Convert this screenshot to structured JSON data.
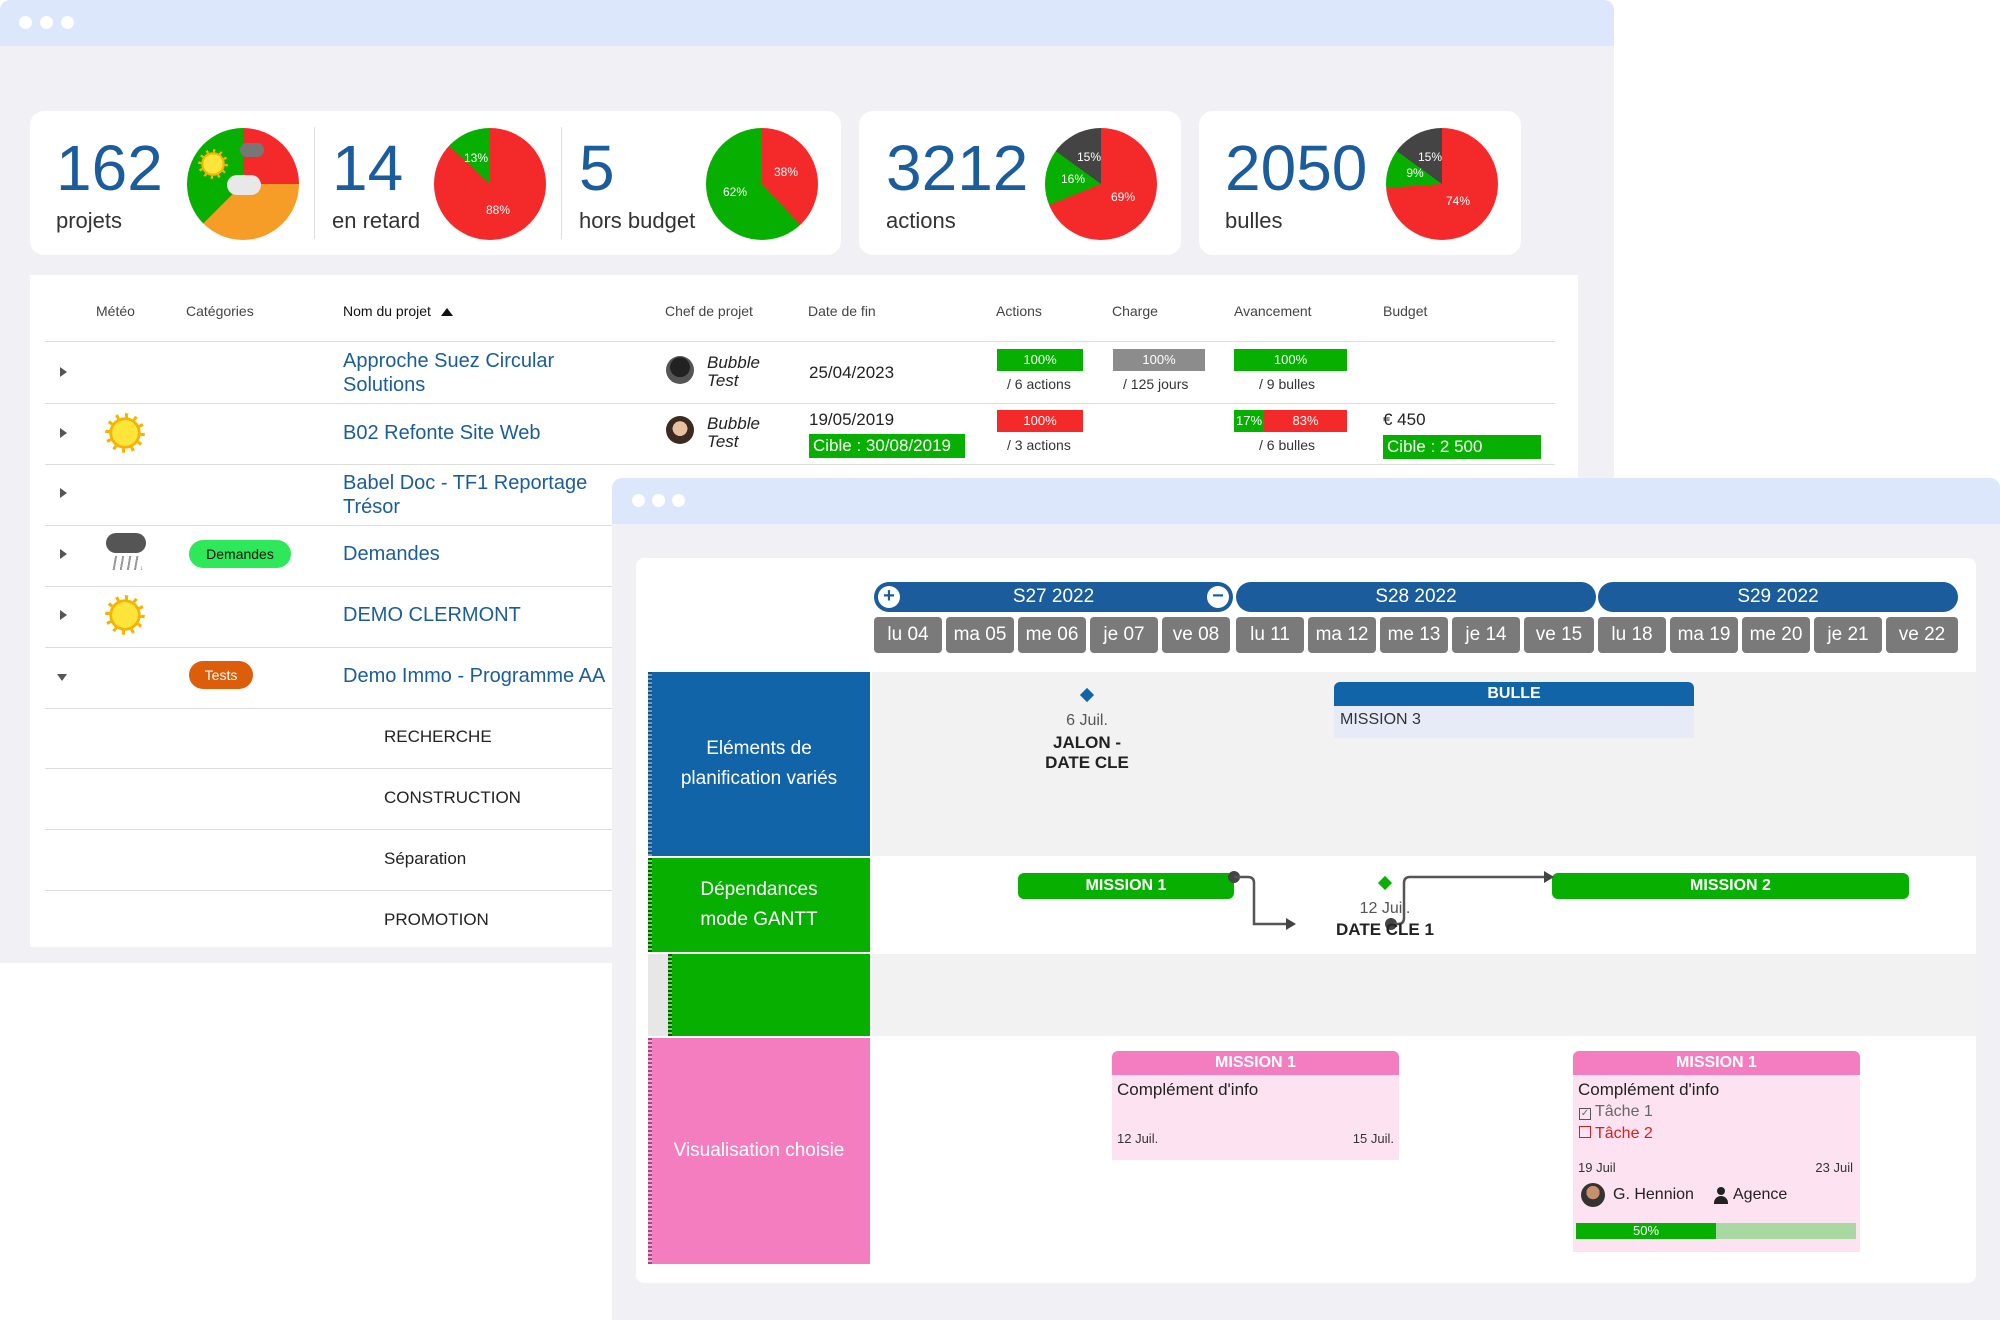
{
  "kpis": [
    {
      "number": "162",
      "label": "projets"
    },
    {
      "number": "14",
      "label": "en retard",
      "pie": [
        "13%",
        "88%"
      ]
    },
    {
      "number": "5",
      "label": "hors budget",
      "pie": [
        "38%",
        "62%"
      ]
    },
    {
      "number": "3212",
      "label": "actions",
      "pie": [
        "15%",
        "16%",
        "69%"
      ]
    },
    {
      "number": "2050",
      "label": "bulles",
      "pie": [
        "15%",
        "9%",
        "74%"
      ]
    }
  ],
  "table": {
    "headers": {
      "meteo": "Météo",
      "categories": "Catégories",
      "nom": "Nom du projet",
      "chef": "Chef de projet",
      "date": "Date de fin",
      "actions": "Actions",
      "charge": "Charge",
      "avancement": "Avancement",
      "budget": "Budget"
    },
    "rows": [
      {
        "name_line1": "Approche Suez Circular",
        "name_line2": "Solutions",
        "chef_line1": "Bubble",
        "chef_line2": "Test",
        "date": "25/04/2023",
        "actions_pct": "100%",
        "actions_sub": "/ 6 actions",
        "charge_pct": "100%",
        "charge_sub": "/ 125 jours",
        "avancement_pct": "100%",
        "avancement_sub": "/ 9 bulles"
      },
      {
        "name": "B02 Refonte Site Web",
        "chef_line1": "Bubble",
        "chef_line2": "Test",
        "date": "19/05/2019",
        "target_date": "Cible : 30/08/2019",
        "actions_pct": "100%",
        "actions_sub": "/ 3 actions",
        "avancement_a": "17%",
        "avancement_b": "83%",
        "avancement_sub": "/ 6 bulles",
        "budget": "€ 450",
        "budget_target": "Cible : 2 500"
      },
      {
        "name_line1": "Babel Doc - TF1 Reportage",
        "name_line2": "Trésor"
      },
      {
        "category": "Demandes",
        "name": "Demandes"
      },
      {
        "name": "DEMO CLERMONT"
      },
      {
        "category": "Tests",
        "name": "Demo Immo - Programme AA"
      }
    ],
    "subrows": [
      "RECHERCHE",
      "CONSTRUCTION",
      "Séparation",
      "PROMOTION"
    ]
  },
  "gantt": {
    "weeks": [
      "S27 2022",
      "S28 2022",
      "S29 2022"
    ],
    "days": [
      "lu 04",
      "ma 05",
      "me 06",
      "je 07",
      "ve 08",
      "lu 11",
      "ma 12",
      "me 13",
      "je 14",
      "ve 15",
      "lu 18",
      "ma 19",
      "me 20",
      "je 21",
      "ve 22"
    ],
    "lanes": {
      "lane1_line1": "Eléments de",
      "lane1_line2": "planification variés",
      "lane2_line1": "Dépendances",
      "lane2_line2": "mode GANTT",
      "lane3": "Visualisation choisie"
    },
    "milestone1": {
      "date": "6 Juil.",
      "line1": "JALON -",
      "line2": "DATE CLE"
    },
    "bulle": {
      "title": "BULLE",
      "content": "MISSION 3"
    },
    "mission1": "MISSION 1",
    "mission2": "MISSION 2",
    "milestone2": {
      "date": "12 Juil.",
      "label": "DATE CLE 1"
    },
    "card1": {
      "title": "MISSION 1",
      "text": "Complément d'info",
      "start": "12 Juil.",
      "end": "15 Juil."
    },
    "card2": {
      "title": "MISSION 1",
      "text": "Complément d'info",
      "task1": "Tâche 1",
      "task2": "Tâche 2",
      "start": "19 Juil",
      "end": "23 Juil",
      "person": "G. Hennion",
      "team": "Agence",
      "progress": "50%"
    }
  },
  "colors": {
    "blue": "#1b5d9c",
    "green": "#07b000",
    "red": "#f42a2a",
    "grey": "#8c8c8c",
    "orange": "#f59d27",
    "pink": "#f47dbf"
  }
}
